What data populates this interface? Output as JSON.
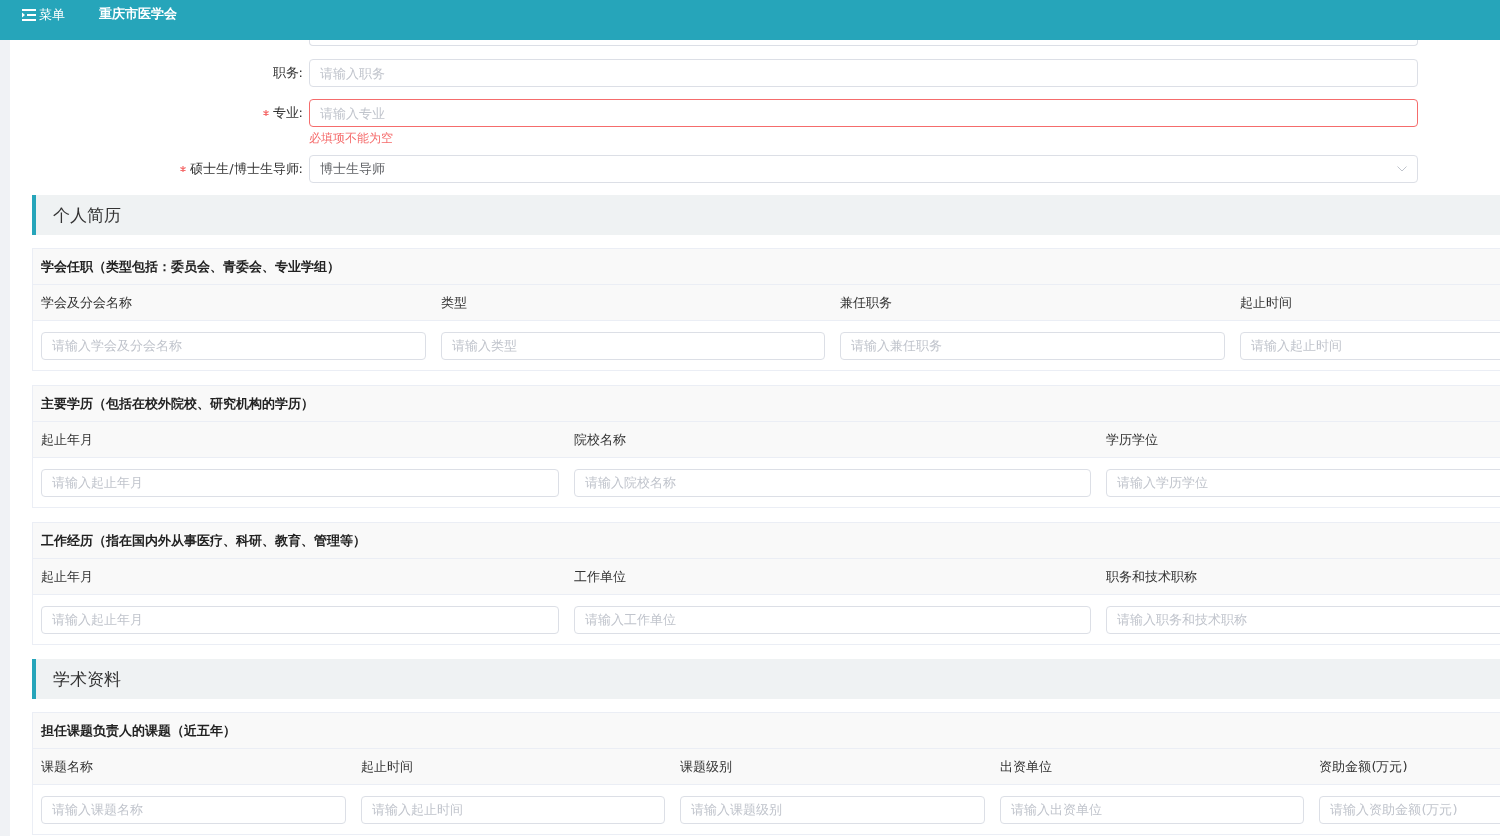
{
  "top_bar": {
    "menu_label": "菜单",
    "title": "重庆市医学会"
  },
  "form_fields": [
    {
      "label": "职务:",
      "required": false,
      "kind": "text",
      "placeholder": "请输入职务"
    },
    {
      "label": "专业:",
      "required": true,
      "kind": "text",
      "placeholder": "请输入专业",
      "error": "必填项不能为空"
    },
    {
      "label": "硕士生/博士生导师:",
      "required": true,
      "kind": "select",
      "value": "博士生导师"
    }
  ],
  "sections": [
    {
      "title": "个人简历",
      "tables": [
        {
          "title": "学会任职（类型包括：委员会、青委会、专业学组）",
          "columns": [
            {
              "label": "学会及分会名称",
              "placeholder": "请输入学会及分会名称"
            },
            {
              "label": "类型",
              "placeholder": "请输入类型"
            },
            {
              "label": "兼任职务",
              "placeholder": "请输入兼任职务"
            },
            {
              "label": "起止时间",
              "placeholder": "请输入起止时间"
            }
          ]
        },
        {
          "title": "主要学历（包括在校外院校、研究机构的学历）",
          "columns": [
            {
              "label": "起止年月",
              "placeholder": "请输入起止年月"
            },
            {
              "label": "院校名称",
              "placeholder": "请输入院校名称"
            },
            {
              "label": "学历学位",
              "placeholder": "请输入学历学位"
            }
          ]
        },
        {
          "title": "工作经历（指在国内外从事医疗、科研、教育、管理等）",
          "columns": [
            {
              "label": "起止年月",
              "placeholder": "请输入起止年月"
            },
            {
              "label": "工作单位",
              "placeholder": "请输入工作单位"
            },
            {
              "label": "职务和技术职称",
              "placeholder": "请输入职务和技术职称"
            }
          ]
        }
      ]
    },
    {
      "title": "学术资料",
      "tables": [
        {
          "title": "担任课题负责人的课题（近五年）",
          "columns": [
            {
              "label": "课题名称",
              "placeholder": "请输入课题名称"
            },
            {
              "label": "起止时间",
              "placeholder": "请输入起止时间"
            },
            {
              "label": "课题级别",
              "placeholder": "请输入课题级别"
            },
            {
              "label": "出资单位",
              "placeholder": "请输入出资单位"
            },
            {
              "label": "资助金额(万元)",
              "placeholder": "请输入资助金额(万元)"
            }
          ]
        }
      ]
    }
  ]
}
